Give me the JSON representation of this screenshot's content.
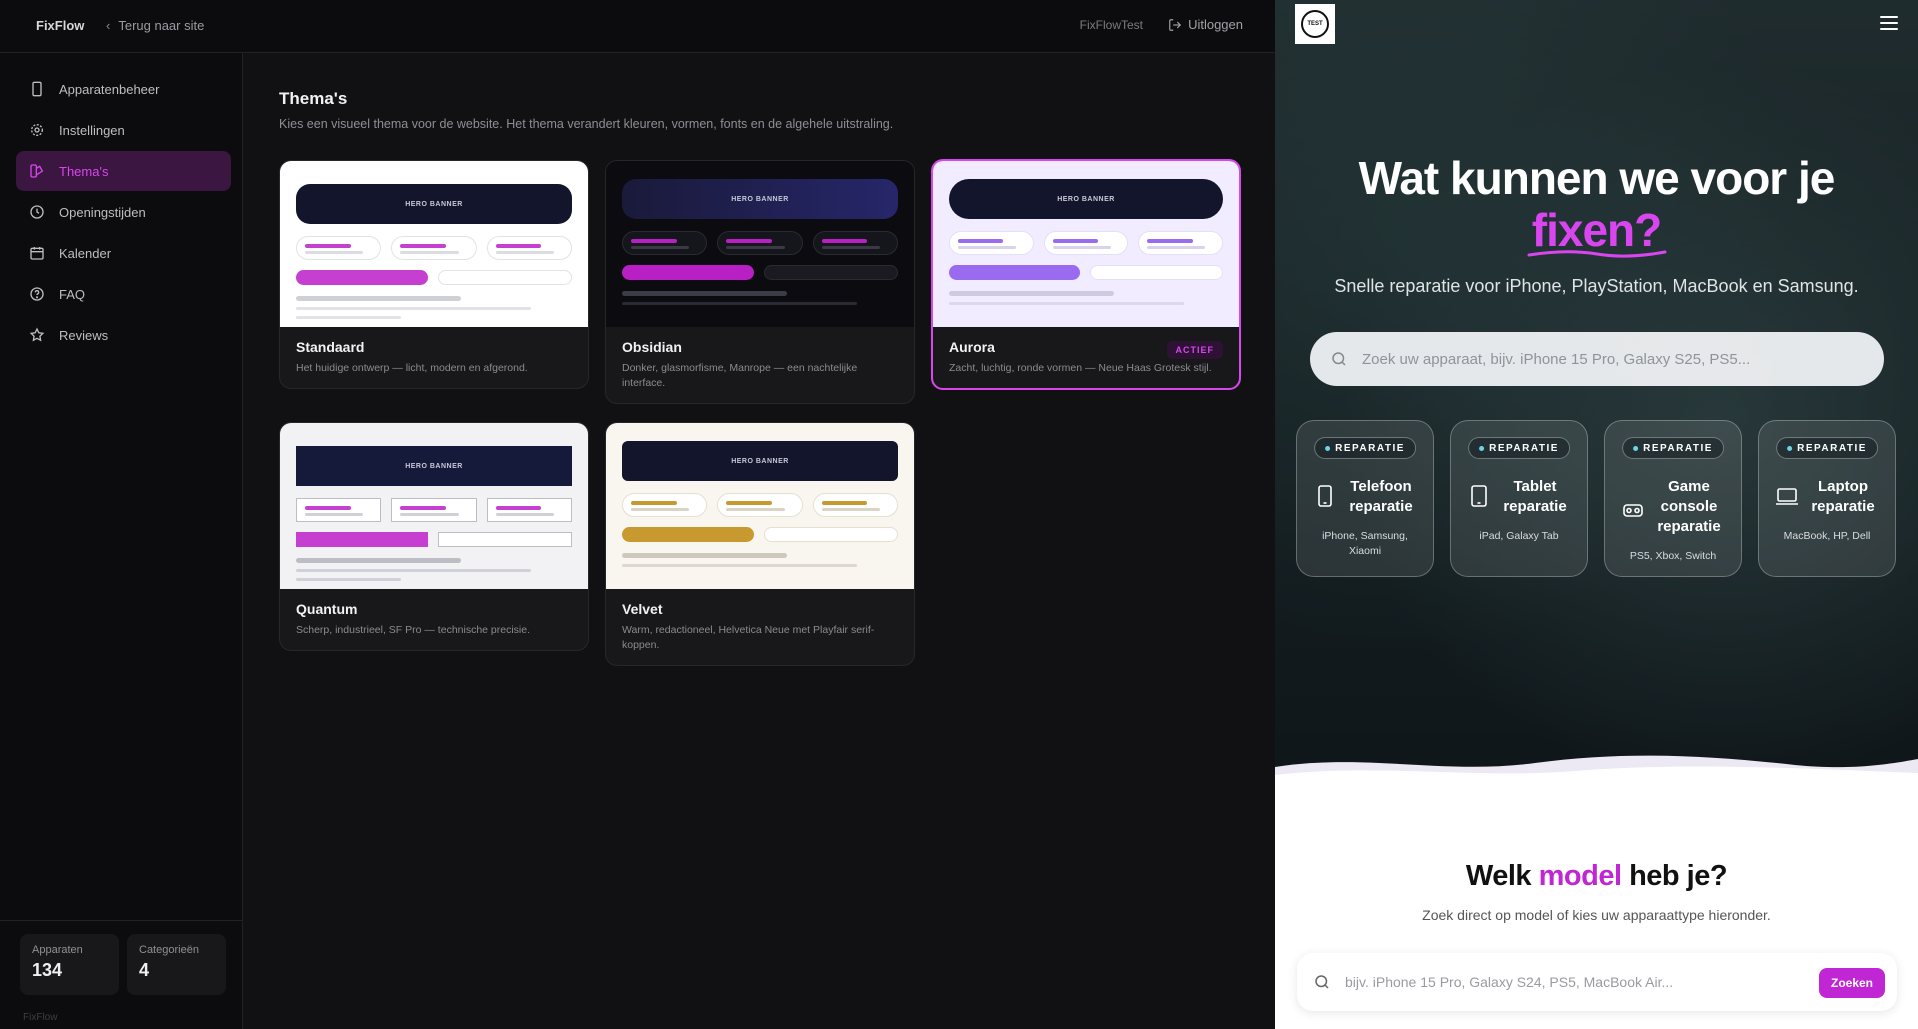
{
  "topbar": {
    "brand": "FixFlow",
    "back_label": "Terug naar site",
    "tenant": "FixFlowTest",
    "logout_label": "Uitloggen"
  },
  "sidebar": {
    "items": [
      {
        "label": "Apparatenbeheer",
        "icon": "device-icon"
      },
      {
        "label": "Instellingen",
        "icon": "gear-icon"
      },
      {
        "label": "Thema's",
        "icon": "palette-icon",
        "active": true
      },
      {
        "label": "Openingstijden",
        "icon": "clock-icon"
      },
      {
        "label": "Kalender",
        "icon": "calendar-icon"
      },
      {
        "label": "FAQ",
        "icon": "help-circle-icon"
      },
      {
        "label": "Reviews",
        "icon": "star-icon"
      }
    ],
    "stats": [
      {
        "label": "Apparaten",
        "value": "134"
      },
      {
        "label": "Categorieën",
        "value": "4"
      }
    ],
    "footer": "FixFlow"
  },
  "main": {
    "title": "Thema's",
    "subtitle": "Kies een visueel thema voor de website. Het thema verandert kleuren, vormen, fonts en de algehele uitstraling.",
    "hero_banner_label": "HERO BANNER",
    "active_badge": "ACTIEF",
    "themes": [
      {
        "name": "Standaard",
        "desc": "Het huidige ontwerp — licht, modern en afgerond."
      },
      {
        "name": "Obsidian",
        "desc": "Donker, glasmorfisme, Manrope — een nachtelijke interface."
      },
      {
        "name": "Aurora",
        "desc": "Zacht, luchtig, ronde vormen — Neue Haas Grotesk stijl.",
        "active": true
      },
      {
        "name": "Quantum",
        "desc": "Scherp, industrieel, SF Pro — technische precisie."
      },
      {
        "name": "Velvet",
        "desc": "Warm, redactioneel, Helvetica Neue met Playfair serif-koppen."
      }
    ]
  },
  "preview": {
    "logo_text": "TEST",
    "hero_title_line1": "Wat kunnen we voor je",
    "hero_title_accent": "fixen?",
    "hero_subtitle": "Snelle reparatie voor iPhone, PlayStation, MacBook en Samsung.",
    "search_placeholder": "Zoek uw apparaat, bijv. iPhone 15 Pro, Galaxy S25, PS5...",
    "category_tag": "REPARATIE",
    "categories": [
      {
        "title": "Telefoon reparatie",
        "sub": "iPhone, Samsung, Xiaomi",
        "icon": "phone-icon"
      },
      {
        "title": "Tablet reparatie",
        "sub": "iPad, Galaxy Tab",
        "icon": "tablet-icon"
      },
      {
        "title": "Game console reparatie",
        "sub": "PS5, Xbox, Switch",
        "icon": "gamepad-icon"
      },
      {
        "title": "Laptop reparatie",
        "sub": "MacBook, HP, Dell",
        "icon": "laptop-icon"
      }
    ],
    "models_title_pre": "Welk ",
    "models_title_accent": "model",
    "models_title_post": " heb je?",
    "models_subtitle": "Zoek direct op model of kies uw apparaattype hieronder.",
    "model_search_placeholder": "bijv. iPhone 15 Pro, Galaxy S24, PS5, MacBook Air...",
    "model_search_button": "Zoeken"
  },
  "colors": {
    "accent": "#d946ef",
    "admin_bg": "#111113",
    "sidebar_bg": "#0c0c0e"
  }
}
